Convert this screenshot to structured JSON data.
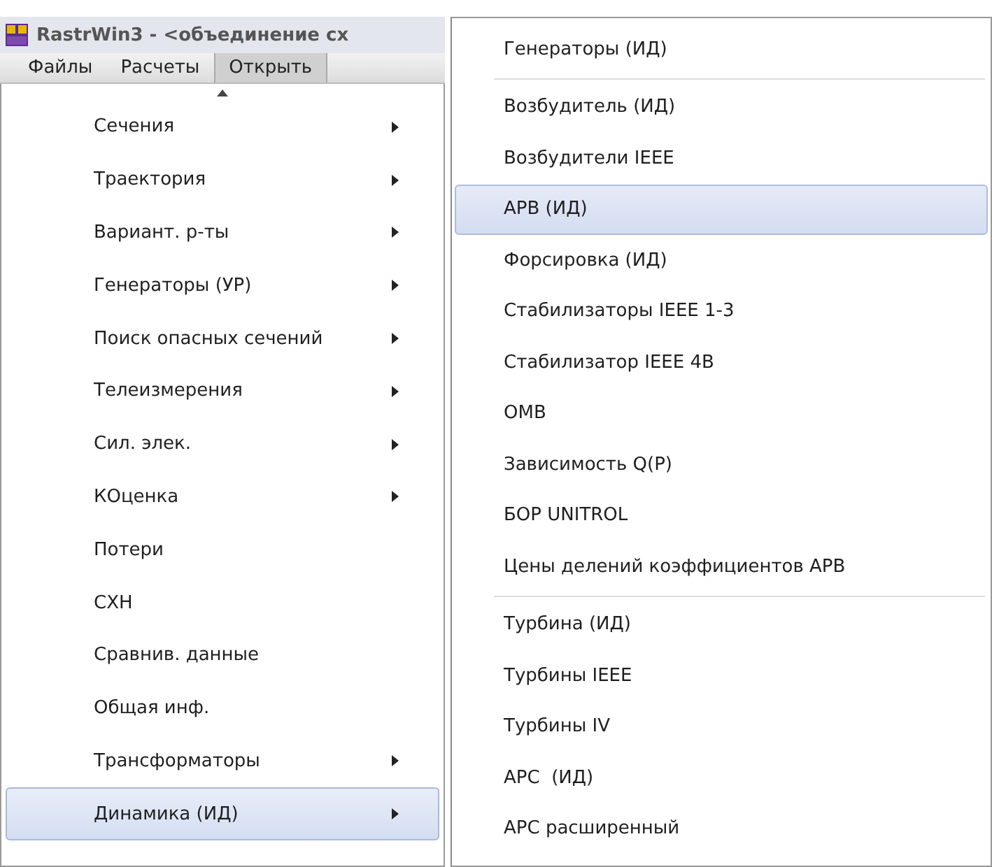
{
  "window": {
    "title": "RastrWin3 - <объединение сх"
  },
  "menu_bar": [
    {
      "label": "Файлы",
      "selected": false
    },
    {
      "label": "Расчеты",
      "selected": false
    },
    {
      "label": "Открыть",
      "selected": true
    }
  ],
  "menu": {
    "items": [
      {
        "label": "Сечения",
        "submenu": true,
        "selected": false
      },
      {
        "label": "Траектория",
        "submenu": true,
        "selected": false
      },
      {
        "label": "Вариант. р-ты",
        "submenu": true,
        "selected": false
      },
      {
        "label": "Генераторы (УР)",
        "submenu": true,
        "selected": false
      },
      {
        "label": "Поиск опасных сечений",
        "submenu": true,
        "selected": false
      },
      {
        "label": "Телеизмерения",
        "submenu": true,
        "selected": false
      },
      {
        "label": "Сил. элек.",
        "submenu": true,
        "selected": false
      },
      {
        "label": "КОценка",
        "submenu": true,
        "selected": false
      },
      {
        "label": "Потери",
        "submenu": false,
        "selected": false
      },
      {
        "label": "СХН",
        "submenu": false,
        "selected": false
      },
      {
        "label": "Сравнив. данные",
        "submenu": false,
        "selected": false
      },
      {
        "label": "Общая инф.",
        "submenu": false,
        "selected": false
      },
      {
        "label": "Трансформаторы",
        "submenu": true,
        "selected": false
      },
      {
        "label": "Динамика (ИД)",
        "submenu": true,
        "selected": true
      }
    ]
  },
  "submenu": {
    "items": [
      {
        "kind": "item",
        "label": "Генераторы (ИД)",
        "selected": false
      },
      {
        "kind": "separator"
      },
      {
        "kind": "item",
        "label": "Возбудитель (ИД)",
        "selected": false
      },
      {
        "kind": "item",
        "label": "Возбудители IEEE",
        "selected": false
      },
      {
        "kind": "item",
        "label": "АРВ (ИД)",
        "selected": true
      },
      {
        "kind": "item",
        "label": "Форсировка (ИД)",
        "selected": false
      },
      {
        "kind": "item",
        "label": "Стабилизаторы IEEE 1-3",
        "selected": false
      },
      {
        "kind": "item",
        "label": "Стабилизатор IEEE 4B",
        "selected": false
      },
      {
        "kind": "item",
        "label": "ОМВ",
        "selected": false
      },
      {
        "kind": "item",
        "label": "Зависимость Q(P)",
        "selected": false
      },
      {
        "kind": "item",
        "label": "БОР UNITROL",
        "selected": false
      },
      {
        "kind": "item",
        "label": "Цены делений коэффициентов АРВ",
        "selected": false
      },
      {
        "kind": "separator"
      },
      {
        "kind": "item",
        "label": "Турбина (ИД)",
        "selected": false
      },
      {
        "kind": "item",
        "label": "Турбины IEEE",
        "selected": false
      },
      {
        "kind": "item",
        "label": "Турбины IV",
        "selected": false
      },
      {
        "kind": "item",
        "label": "АРС  (ИД)",
        "selected": false
      },
      {
        "kind": "item",
        "label": "АРС расширенный",
        "selected": false
      }
    ]
  }
}
